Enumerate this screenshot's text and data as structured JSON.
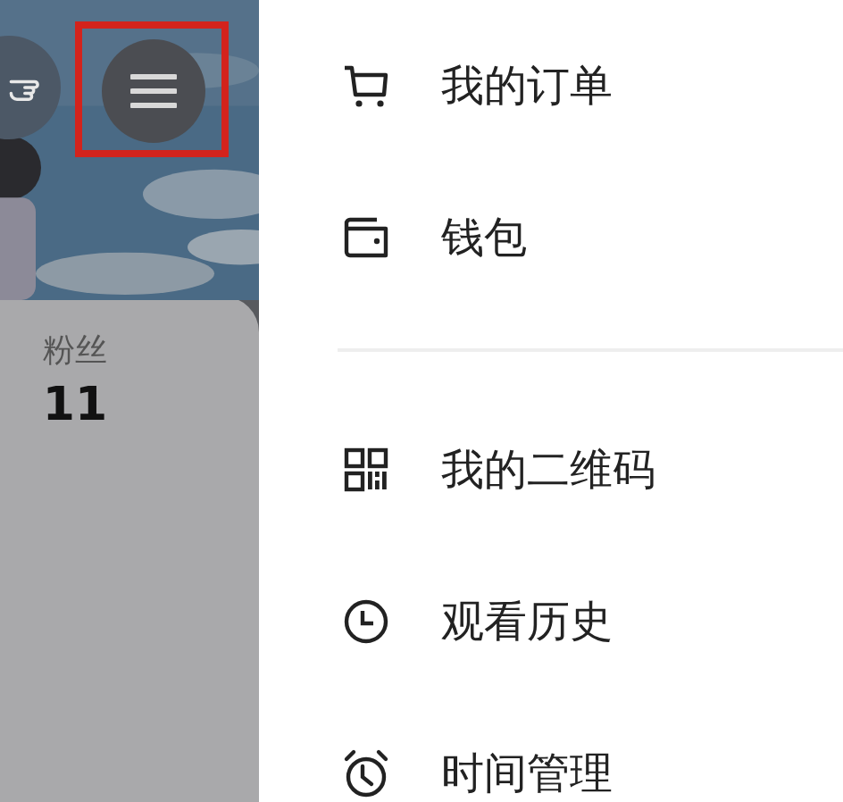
{
  "profile": {
    "menu_button": {
      "highlighted": true
    },
    "stats": [
      {
        "label": "粉丝",
        "value": "11"
      }
    ]
  },
  "drawer": {
    "groups": [
      {
        "items": [
          {
            "label": "我的订单"
          },
          {
            "label": "钱包"
          }
        ]
      },
      {
        "items": [
          {
            "label": "我的二维码"
          },
          {
            "label": "观看历史"
          },
          {
            "label": "时间管理"
          }
        ]
      }
    ]
  }
}
